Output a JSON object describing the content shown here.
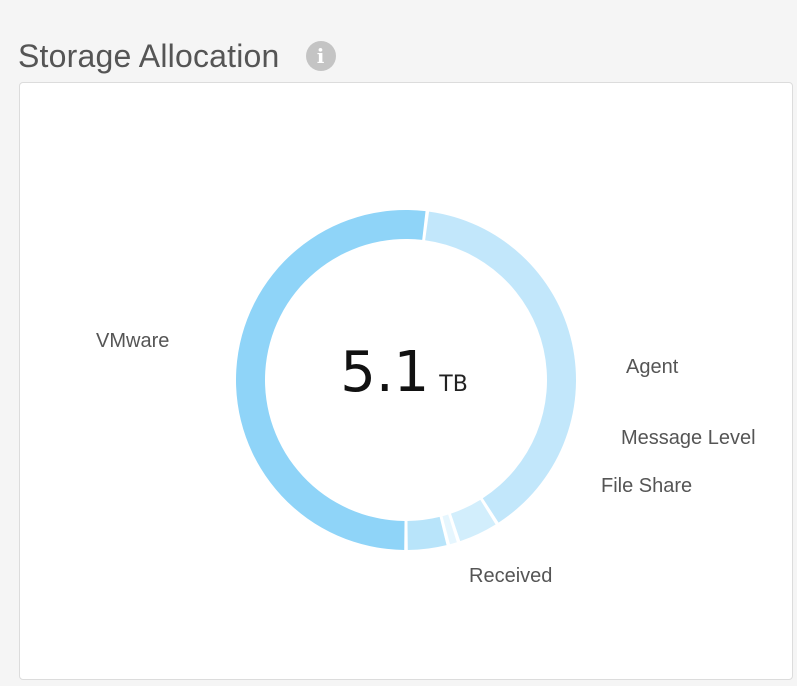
{
  "widget": {
    "title": "Storage Allocation",
    "info_icon": "info-icon"
  },
  "center": {
    "value": "5.1",
    "unit": "TB"
  },
  "colors": {
    "background": "#f5f5f5",
    "card": "#ffffff",
    "info_icon": "#c4c4c4"
  },
  "chart_data": {
    "type": "pie",
    "variant": "donut",
    "total": 5.1,
    "total_unit": "TB",
    "slices": [
      {
        "label": "VMware",
        "value": 52,
        "color": "#8fd4f8"
      },
      {
        "label": "Agent",
        "value": 39,
        "color": "#c2e7fb"
      },
      {
        "label": "File Share",
        "value": 4,
        "color": "#d2eefc"
      },
      {
        "label": "Message Level",
        "value": 1,
        "color": "#e6f6fe"
      },
      {
        "label": "Received",
        "value": 4,
        "color": "#b8e4fa"
      }
    ]
  }
}
